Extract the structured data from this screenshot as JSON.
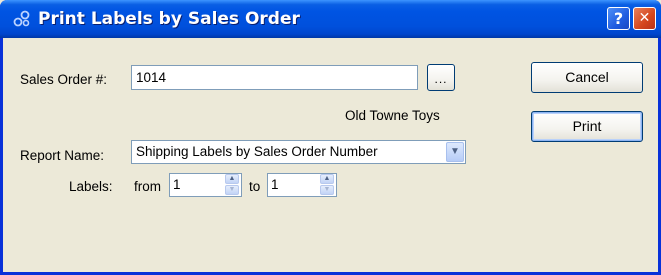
{
  "window": {
    "title": "Print Labels by Sales Order",
    "help_glyph": "?",
    "close_glyph": "✕"
  },
  "sales_order": {
    "label": "Sales Order #:",
    "value": "1014",
    "browse_label": "..."
  },
  "customer_name": "Old Towne Toys",
  "report": {
    "label": "Report Name:",
    "selected": "Shipping Labels by Sales Order Number"
  },
  "labels": {
    "label": "Labels:",
    "from_label": "from",
    "from_value": "1",
    "to_label": "to",
    "to_value": "1"
  },
  "buttons": {
    "cancel": "Cancel",
    "print": "Print"
  },
  "icons": {
    "title": "link-chain-icon",
    "dropdown": "chevron-down-icon",
    "spin_up": "triangle-up-icon",
    "spin_down": "triangle-down-icon"
  }
}
